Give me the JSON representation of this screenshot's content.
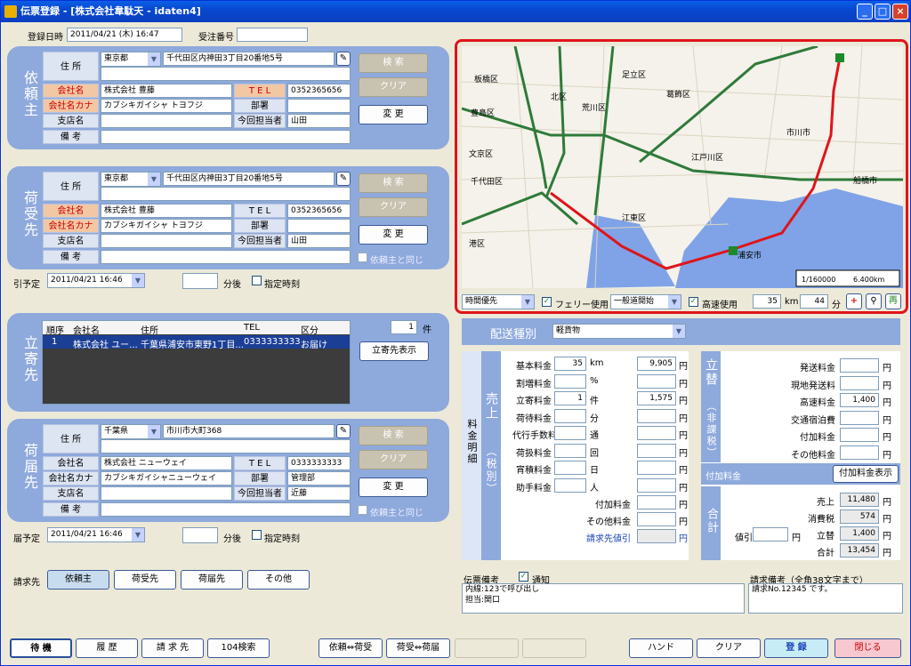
{
  "title": "伝票登録 - [株式会社韋駄天 - idaten4]",
  "header": {
    "reg_label": "登録日時",
    "reg_value": "2011/04/21 (木) 16:47",
    "order_label": "受注番号",
    "order_value": ""
  },
  "irainushi": {
    "side": "依頼主",
    "pref": "東京都",
    "addr": "千代田区内神田3丁目20番地5号",
    "company": "株式会社 豊藤",
    "kana": "カブシキガイシャ トヨフジ",
    "tel": "0352365656",
    "branch": "",
    "dept": "",
    "person": "山田",
    "note": ""
  },
  "niuke": {
    "side": "荷受先",
    "pref": "東京都",
    "addr": "千代田区内神田3丁目20番地5号",
    "company": "株式会社 豊藤",
    "kana": "カブシキガイシャ トヨフジ",
    "tel": "0352365656",
    "branch": "",
    "dept": "",
    "person": "山田",
    "note": "",
    "same": "依頼主と同じ"
  },
  "nitodoke": {
    "side": "荷届先",
    "pref": "千葉県",
    "addr": "市川市大町368",
    "company": "株式会社 ニューウェイ",
    "kana": "カブシキガイシャニューウェイ",
    "tel": "0333333333",
    "branch": "",
    "dept": "管理部",
    "person": "近藤",
    "note": "",
    "same": "依頼主と同じ"
  },
  "labels": {
    "addr": "住 所",
    "company": "会社名",
    "kana": "会社名カナ",
    "tel": "T E L",
    "branch": "支店名",
    "dept": "部署",
    "person": "今回担当者",
    "note": "備 考",
    "search": "検 索",
    "clear": "クリア",
    "change": "変 更",
    "after": "分後",
    "fixed": "指定時刻"
  },
  "pickup": {
    "label": "引予定",
    "date": "2011/04/21 16:46",
    "min": ""
  },
  "delivery": {
    "label": "届予定",
    "date": "2011/04/21 16:46",
    "min": ""
  },
  "stops": {
    "side": "立寄先",
    "count": "1",
    "count_unit": "件",
    "headers": [
      "順序",
      "会社名",
      "住所",
      "TEL",
      "区分"
    ],
    "rows": [
      [
        "1",
        "株式会社 ユー...",
        "千葉県浦安市東野1丁目...",
        "0333333333",
        "お届け"
      ]
    ],
    "show_btn": "立寄先表示"
  },
  "bill": {
    "label": "請求先",
    "options": [
      "依頼主",
      "荷受先",
      "荷届先",
      "その他"
    ]
  },
  "map": {
    "scale_ratio": "1/160000",
    "scale_km": "6.400km",
    "places": [
      "板橋区",
      "北区",
      "足立区",
      "葛飾区",
      "豊島区",
      "荒川区",
      "市川市",
      "文京区",
      "江戸川区",
      "船橋市",
      "千代田区",
      "江東区",
      "港区",
      "浦安市"
    ]
  },
  "route": {
    "mode": "時間優先",
    "ferry": "フェリー使用",
    "road": "一般道開始",
    "hw": "高速使用",
    "km": "35",
    "km_unit": "km",
    "min": "44",
    "min_unit": "分",
    "redo": "再"
  },
  "delivery_type": {
    "label": "配送種別",
    "value": "軽貨物"
  },
  "charges": {
    "vert": "料金明細",
    "uriage": "売上",
    "zei": "（税別）",
    "rows": [
      {
        "label": "基本料金",
        "qty": "35",
        "unit": "km",
        "amount": "9,905"
      },
      {
        "label": "割増料金",
        "qty": "",
        "unit": "%",
        "amount": ""
      },
      {
        "label": "立寄料金",
        "qty": "1",
        "unit": "件",
        "amount": "1,575"
      },
      {
        "label": "荷待料金",
        "qty": "",
        "unit": "分",
        "amount": ""
      },
      {
        "label": "代行手数料",
        "qty": "",
        "unit": "通",
        "amount": ""
      },
      {
        "label": "荷扱料金",
        "qty": "",
        "unit": "回",
        "amount": ""
      },
      {
        "label": "宵積料金",
        "qty": "",
        "unit": "日",
        "amount": ""
      },
      {
        "label": "助手料金",
        "qty": "",
        "unit": "人",
        "amount": ""
      }
    ],
    "extra": [
      {
        "label": "付加料金",
        "amount": ""
      },
      {
        "label": "その他料金",
        "amount": ""
      },
      {
        "label": "請求先値引",
        "amount": ""
      }
    ],
    "yen": "円"
  },
  "tatekae": {
    "label": "立替",
    "sub": "（非課税）",
    "rows": [
      {
        "label": "発送料金",
        "amount": ""
      },
      {
        "label": "現地発送料",
        "amount": ""
      },
      {
        "label": "高速料金",
        "amount": "1,400"
      },
      {
        "label": "交通宿泊費",
        "amount": ""
      },
      {
        "label": "付加料金",
        "amount": ""
      },
      {
        "label": "その他料金",
        "amount": ""
      }
    ]
  },
  "fuka": {
    "label": "付加料金",
    "btn": "付加料金表示"
  },
  "total": {
    "label": "合計",
    "discount_label": "値引",
    "discount": "",
    "rows": [
      {
        "label": "売上",
        "amount": "11,480"
      },
      {
        "label": "消費税",
        "amount": "574"
      },
      {
        "label": "立替",
        "amount": "1,400"
      },
      {
        "label": "合計",
        "amount": "13,454"
      }
    ]
  },
  "memo": {
    "label": "伝票備考",
    "notify": "通知",
    "text1": "内線:123で呼び出し",
    "text2": "担当:関口",
    "req_label": "請求備考（全角38文字まで）",
    "req_text": "請求No.12345 です。"
  },
  "footer": {
    "btns": [
      "待 機",
      "履 歴",
      "請 求 先",
      "104検索",
      "依頼⇔荷受",
      "荷受⇔荷届",
      "",
      "",
      "ハンド",
      "クリア",
      "登 録",
      "閉じる"
    ]
  }
}
